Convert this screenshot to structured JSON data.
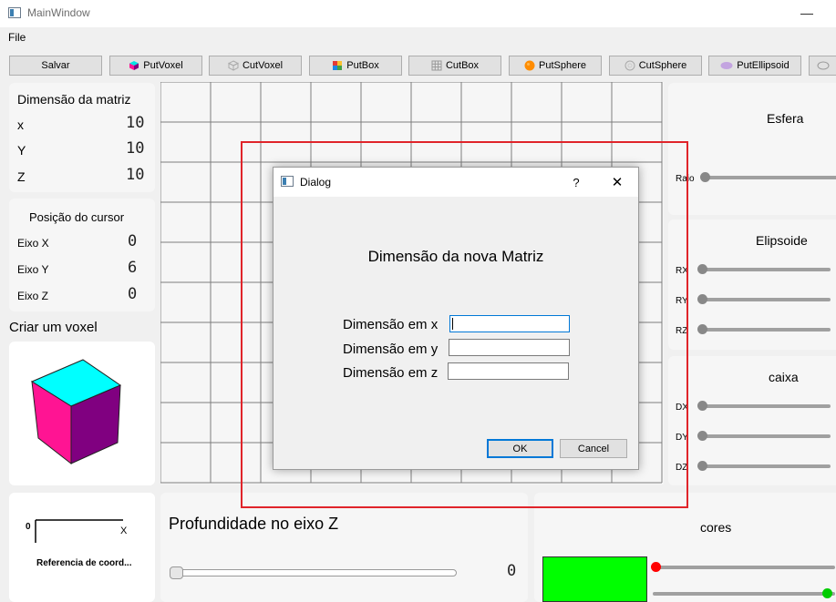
{
  "window": {
    "title": "MainWindow",
    "minimize_glyph": "—"
  },
  "menu": {
    "file": "File"
  },
  "toolbar": {
    "buttons": [
      {
        "label": "Salvar",
        "icon": ""
      },
      {
        "label": "PutVoxel",
        "icon": "voxel-icon"
      },
      {
        "label": "CutVoxel",
        "icon": "cut-voxel-icon"
      },
      {
        "label": "PutBox",
        "icon": "box-icon"
      },
      {
        "label": "CutBox",
        "icon": "cut-box-icon"
      },
      {
        "label": "PutSphere",
        "icon": "sphere-icon"
      },
      {
        "label": "CutSphere",
        "icon": "cut-sphere-icon"
      },
      {
        "label": "PutEllipsoid",
        "icon": "ellipsoid-icon"
      }
    ]
  },
  "matrix": {
    "title": "Dimensão da matriz",
    "rows": [
      {
        "label": "x",
        "value": "10"
      },
      {
        "label": "Y",
        "value": "10"
      },
      {
        "label": "Z",
        "value": "10"
      }
    ]
  },
  "cursor": {
    "title": "Posição do cursor",
    "rows": [
      {
        "label": "Eixo X",
        "value": "0"
      },
      {
        "label": "Eixo Y",
        "value": "6"
      },
      {
        "label": "Eixo Z",
        "value": "0"
      }
    ]
  },
  "voxel": {
    "title": "Criar um voxel",
    "top_color": "#00ffff",
    "left_color": "#ff1493",
    "right_color": "#800080"
  },
  "coords": {
    "origin": "0",
    "axis_x": "X",
    "caption": "Referencia de coord..."
  },
  "depth": {
    "title": "Profundidade no eixo Z",
    "value": "0",
    "level": 0
  },
  "esfera": {
    "title": "Esfera",
    "sliders": [
      {
        "label": "Raio",
        "level": 0
      }
    ]
  },
  "elipsoide": {
    "title": "Elipsoide",
    "sliders": [
      {
        "label": "RX",
        "level": 0
      },
      {
        "label": "RY",
        "level": 0
      },
      {
        "label": "RZ",
        "level": 0
      }
    ]
  },
  "caixa": {
    "title": "caixa",
    "sliders": [
      {
        "label": "DX",
        "level": 0
      },
      {
        "label": "DY",
        "level": 0
      },
      {
        "label": "DZ",
        "level": 0
      }
    ]
  },
  "cores": {
    "title": "cores",
    "swatch": "#00ff00",
    "red_handle": "#ff0000",
    "green_handle": "#00cc00"
  },
  "dialog": {
    "title": "Dialog",
    "help": "?",
    "close": "✕",
    "heading": "Dimensão da nova Matriz",
    "fields": [
      {
        "label": "Dimensão em x",
        "value": ""
      },
      {
        "label": "Dimensão em y",
        "value": ""
      },
      {
        "label": "Dimensão em z",
        "value": ""
      }
    ],
    "ok": "OK",
    "cancel": "Cancel"
  }
}
